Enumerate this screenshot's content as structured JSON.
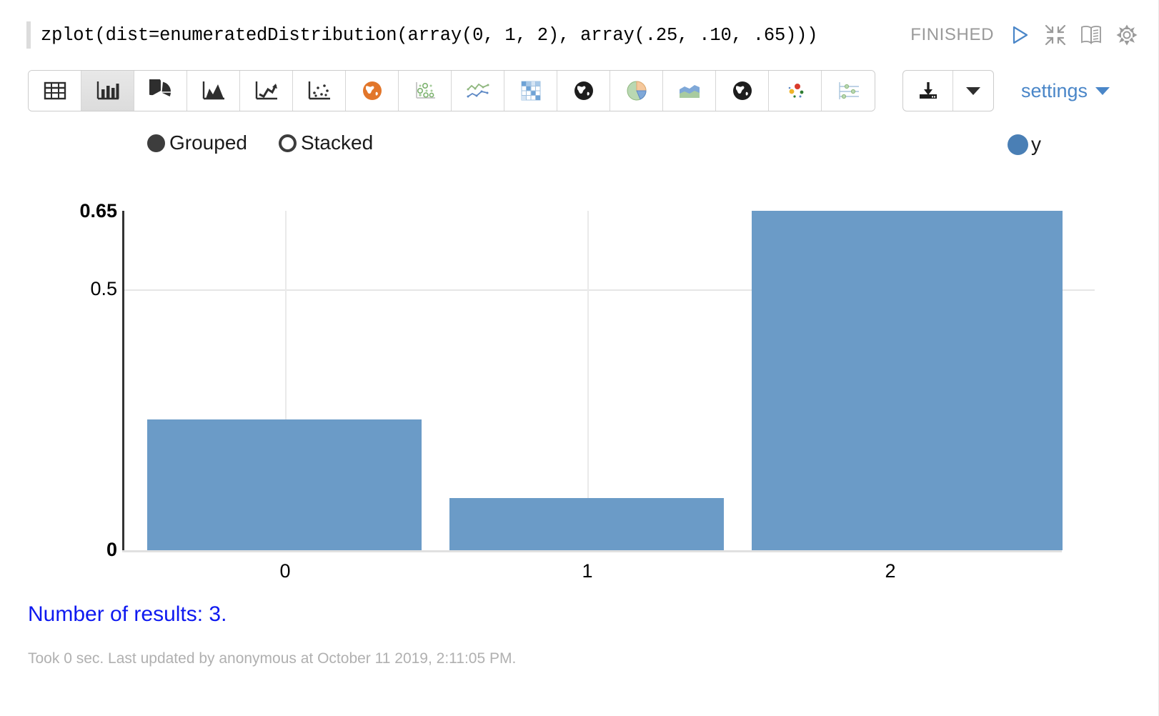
{
  "paragraph": {
    "code": "zplot(dist=enumeratedDistribution(array(0, 1, 2), array(.25, .10, .65)))",
    "status": "FINISHED",
    "icons": [
      {
        "name": "run-play-icon",
        "title": "Run"
      },
      {
        "name": "collapse-arrows-icon",
        "title": "Minimize"
      },
      {
        "name": "book-icon",
        "title": "Show title / book"
      },
      {
        "name": "gear-icon",
        "title": "Settings"
      }
    ]
  },
  "toolbar": {
    "viz_buttons": [
      {
        "name": "table-icon",
        "label": "Table",
        "active": false
      },
      {
        "name": "bar-chart-icon",
        "label": "Bar Chart",
        "active": true
      },
      {
        "name": "pie-chart-icon",
        "label": "Pie Chart",
        "active": false
      },
      {
        "name": "area-chart-icon",
        "label": "Area Chart",
        "active": false
      },
      {
        "name": "line-chart-icon",
        "label": "Line Chart",
        "active": false
      },
      {
        "name": "scatter-chart-icon",
        "label": "Scatter Chart",
        "active": false
      },
      {
        "name": "orange-globe-icon",
        "label": "Map",
        "active": false
      },
      {
        "name": "bubble-chart-icon",
        "label": "Bubble Chart",
        "active": false
      },
      {
        "name": "spline-chart-icon",
        "label": "Spline Chart",
        "active": false
      },
      {
        "name": "heatmap-grid-icon",
        "label": "Heatmap",
        "active": false
      },
      {
        "name": "black-globe-icon",
        "label": "Globe",
        "active": false
      },
      {
        "name": "multi-pie-icon",
        "label": "Donut",
        "active": false
      },
      {
        "name": "stacked-area-icon",
        "label": "Stacked Area",
        "active": false
      },
      {
        "name": "black-globe-2-icon",
        "label": "World Map",
        "active": false
      },
      {
        "name": "dot-cloud-icon",
        "label": "Dot Cloud",
        "active": false
      },
      {
        "name": "lollipop-chart-icon",
        "label": "Dot Plot",
        "active": false
      }
    ],
    "download_label": "Download",
    "download_caret_label": "Download options",
    "settings_label": "settings"
  },
  "chart_controls": {
    "options": [
      {
        "name": "grouped",
        "label": "Grouped",
        "selected": true
      },
      {
        "name": "stacked",
        "label": "Stacked",
        "selected": false
      }
    ]
  },
  "chart_data": {
    "type": "bar",
    "title": "",
    "xlabel": "",
    "ylabel": "",
    "categories": [
      "0",
      "1",
      "2"
    ],
    "series": [
      {
        "name": "y",
        "color": "#6b9bc7",
        "values": [
          0.25,
          0.1,
          0.65
        ]
      }
    ],
    "legend": [
      {
        "label": "y",
        "color": "#4a7fb5"
      }
    ],
    "legend_position": "top-right",
    "ylim": [
      0,
      0.65
    ],
    "yticks": [
      {
        "value": 0.65,
        "label": "0.65",
        "bold": true
      },
      {
        "value": 0.5,
        "label": "0.5",
        "bold": false
      },
      {
        "value": 0,
        "label": "0",
        "bold": true
      }
    ],
    "xticks": [
      "0",
      "1",
      "2"
    ],
    "grid": {
      "horizontal": [
        0.5
      ],
      "vertical": [
        0,
        1
      ]
    },
    "bar_mode": "Grouped"
  },
  "results": {
    "text": "Number of results: 3.",
    "color": "#0e19f0"
  },
  "footer": {
    "text": "Took 0 sec. Last updated by anonymous at October 11 2019, 2:11:05 PM."
  }
}
